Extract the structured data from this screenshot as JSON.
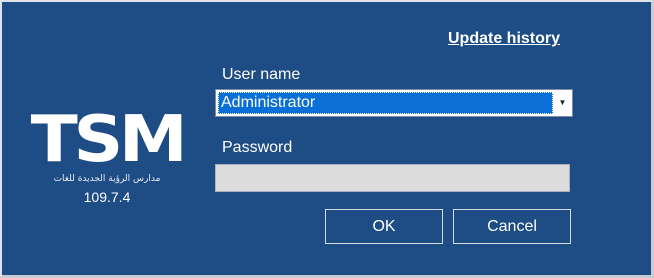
{
  "header": {
    "update_history_label": "Update history"
  },
  "branding": {
    "logo_text": "TSM",
    "tagline": "مدارس الرؤية الجديدة للغات",
    "version": "109.7.4"
  },
  "form": {
    "user_name_label": "User name",
    "user_name_value": "Administrator",
    "password_label": "Password",
    "password_value": ""
  },
  "buttons": {
    "ok_label": "OK",
    "cancel_label": "Cancel"
  },
  "icons": {
    "dropdown": "chevron-down-icon"
  },
  "colors": {
    "background": "#1e4c84",
    "selection": "#0a6fd6",
    "password_field": "#dcdcdc"
  }
}
